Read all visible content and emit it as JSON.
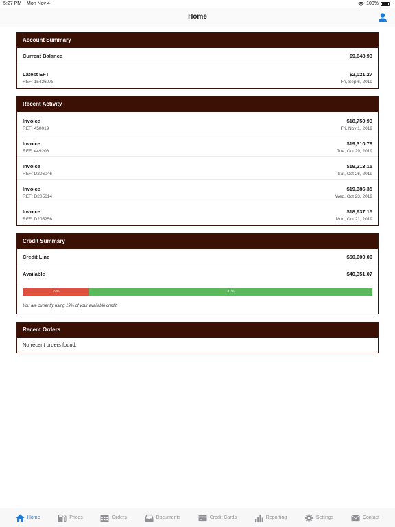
{
  "status": {
    "time": "5:27 PM",
    "date": "Mon Nov 4",
    "battery": "100%"
  },
  "nav": {
    "title": "Home"
  },
  "account_summary": {
    "title": "Account Summary",
    "balance_label": "Current Balance",
    "balance_value": "$9,648.93",
    "eft_label": "Latest EFT",
    "eft_value": "$2,021.27",
    "eft_ref": "REF: 15426078",
    "eft_date": "Fri, Sep 6, 2019"
  },
  "recent_activity": {
    "title": "Recent Activity",
    "items": [
      {
        "label": "Invoice",
        "amount": "$18,750.93",
        "ref": "REF: 450019",
        "date": "Fri, Nov 1, 2019"
      },
      {
        "label": "Invoice",
        "amount": "$19,310.78",
        "ref": "REF: 449208",
        "date": "Tue, Oct 29, 2019"
      },
      {
        "label": "Invoice",
        "amount": "$19,213.15",
        "ref": "REF: D206046",
        "date": "Sat, Oct 26, 2019"
      },
      {
        "label": "Invoice",
        "amount": "$19,386.35",
        "ref": "REF: D205614",
        "date": "Wed, Oct 23, 2019"
      },
      {
        "label": "Invoice",
        "amount": "$18,937.15",
        "ref": "REF: D205256",
        "date": "Mon, Oct 21, 2019"
      }
    ]
  },
  "credit_summary": {
    "title": "Credit Summary",
    "line_label": "Credit Line",
    "line_value": "$50,000.00",
    "available_label": "Available",
    "available_value": "$40,351.07",
    "used_percent": 19,
    "used_label": "19%",
    "available_percent_label": "81%",
    "note": "You are currently using 19% of your available credit."
  },
  "recent_orders": {
    "title": "Recent Orders",
    "empty_text": "No recent orders found."
  },
  "tabs": [
    {
      "label": "Home",
      "icon": "home-icon"
    },
    {
      "label": "Prices",
      "icon": "fuel-pump-icon"
    },
    {
      "label": "Orders",
      "icon": "calendar-icon"
    },
    {
      "label": "Documents",
      "icon": "inbox-icon"
    },
    {
      "label": "Credit Cards",
      "icon": "credit-card-icon"
    },
    {
      "label": "Reporting",
      "icon": "bar-chart-icon"
    },
    {
      "label": "Settings",
      "icon": "gear-icon"
    },
    {
      "label": "Contact",
      "icon": "envelope-icon"
    }
  ],
  "colors": {
    "header_bg": "#3b1005",
    "active_tab": "#1a7bd8",
    "inactive_tab": "#8e8e93",
    "credit_used": "#e05040",
    "credit_available": "#5cb85c"
  }
}
